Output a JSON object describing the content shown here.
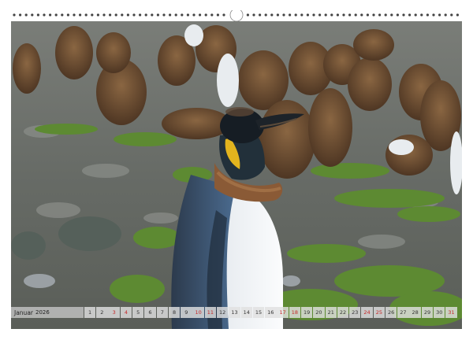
{
  "calendar": {
    "month": "Januar",
    "year": "2026",
    "days": [
      "1",
      "2",
      "3",
      "4",
      "5",
      "6",
      "7",
      "8",
      "9",
      "10",
      "11",
      "12",
      "13",
      "14",
      "15",
      "16",
      "17",
      "18",
      "19",
      "20",
      "21",
      "22",
      "23",
      "24",
      "25",
      "26",
      "27",
      "28",
      "29",
      "30",
      "31"
    ],
    "weekend_days": [
      "3",
      "4",
      "10",
      "11",
      "17",
      "18",
      "24",
      "25",
      "31"
    ],
    "weekend_color": "#c62828"
  },
  "photo": {
    "subject": "king-penguin",
    "background": "penguin-chicks-colony"
  }
}
